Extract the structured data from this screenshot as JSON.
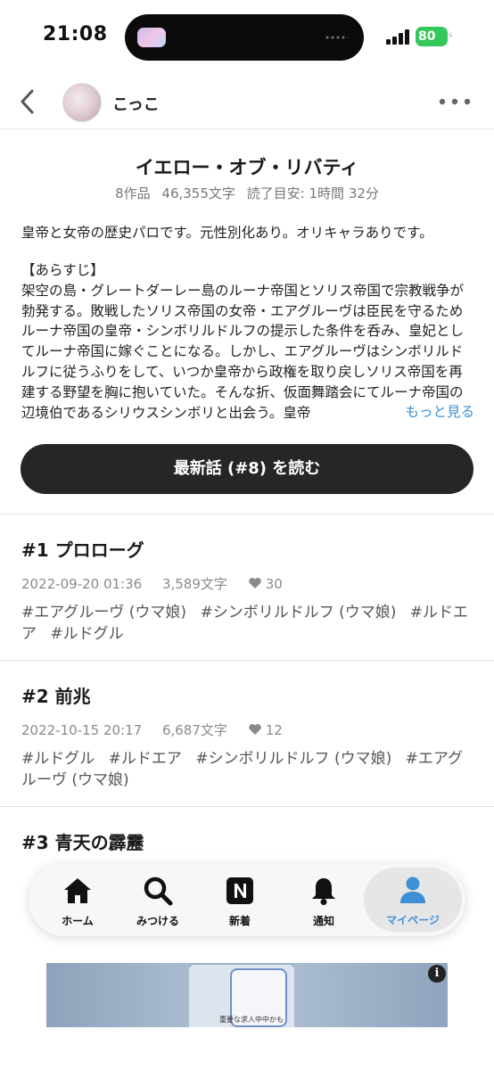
{
  "status_bar": {
    "time": "21:08",
    "battery": "80"
  },
  "header": {
    "author": "こっこ"
  },
  "series": {
    "title": "イエロー・オブ・リバティ",
    "works": "8作品",
    "chars": "46,355文字",
    "read_time": "読了目安: 1時間 32分",
    "summary": "皇帝と女帝の歴史パロです。元性別化あり。オリキャラありです。",
    "synopsis_heading": "【あらすじ】",
    "synopsis": "架空の島・グレートダーレー島のルーナ帝国とソリス帝国で宗教戦争が勃発する。敗戦したソリス帝国の女帝・エアグルーヴは臣民を守るためルーナ帝国の皇帝・シンボリルドルフの提示した条件を呑み、皇妃としてルーナ帝国に嫁ぐことになる。しかし、エアグルーヴはシンボリルドルフに従うふりをして、いつか皇帝から政権を取り戻しソリス帝国を再建する野望を胸に抱いていた。そんな折、仮面舞踏会にてルーナ帝国の辺境伯であるシリウスシンボリと出会う。皇帝",
    "read_more": "もっと見る",
    "cta": "最新話 (#8) を読む"
  },
  "episodes": [
    {
      "title": "#1 プロローグ",
      "date": "2022-09-20 01:36",
      "chars": "3,589文字",
      "likes": "30",
      "tags": [
        "#エアグルーヴ (ウマ娘)",
        "#シンボリルドルフ (ウマ娘)",
        "#ルドエア",
        "#ルドグル"
      ]
    },
    {
      "title": "#2 前兆",
      "date": "2022-10-15 20:17",
      "chars": "6,687文字",
      "likes": "12",
      "tags": [
        "#ルドグル",
        "#ルドエア",
        "#シンボリルドルフ (ウマ娘)",
        "#エアグルーヴ (ウマ娘)"
      ]
    },
    {
      "title": "#3 青天の霹靂"
    }
  ],
  "tabbar": {
    "items": [
      {
        "label": "ホーム",
        "icon": "home-icon"
      },
      {
        "label": "みつける",
        "icon": "search-icon"
      },
      {
        "label": "新着",
        "icon": "new-icon"
      },
      {
        "label": "通知",
        "icon": "bell-icon"
      },
      {
        "label": "マイページ",
        "icon": "person-icon"
      }
    ],
    "active_color": "#3d8fd6"
  },
  "ad": {
    "info": "i",
    "caption": "重要な求人中中かも"
  }
}
